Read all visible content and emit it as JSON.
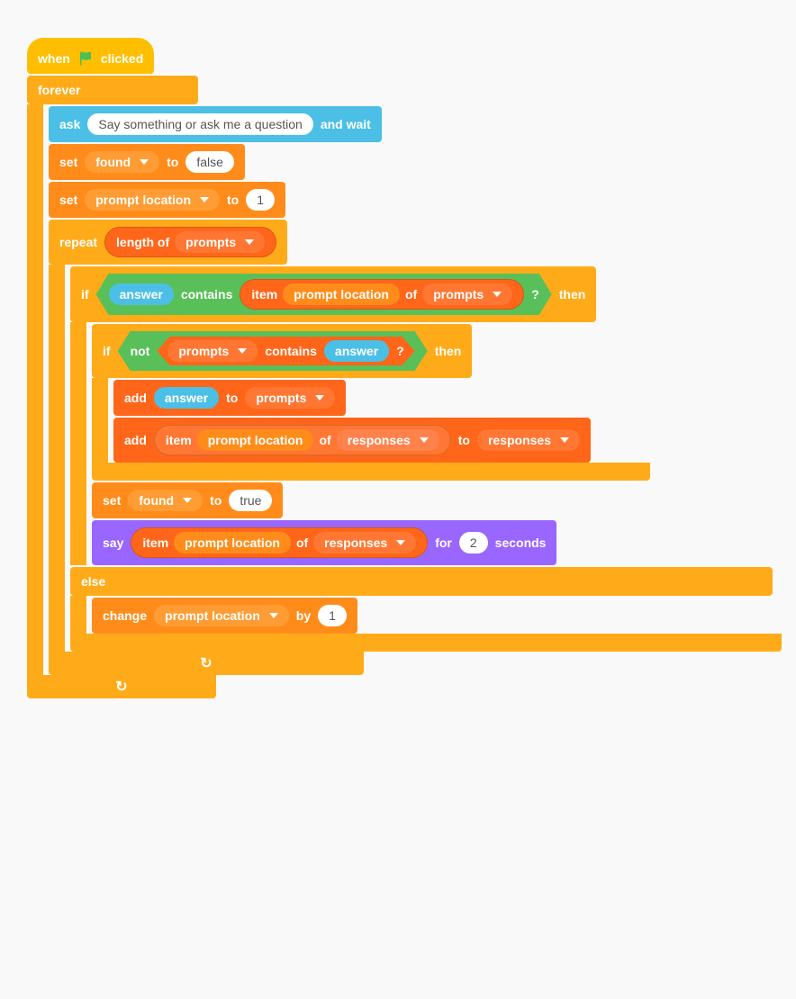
{
  "hat": {
    "when": "when",
    "clicked": "clicked"
  },
  "forever": "forever",
  "ask": {
    "label": "ask",
    "prompt": "Say something or ask me a question",
    "wait": "and wait"
  },
  "set1": {
    "set": "set",
    "var": "found",
    "to": "to",
    "val": "false"
  },
  "set2": {
    "set": "set",
    "var": "prompt location",
    "to": "to",
    "val": "1"
  },
  "repeat": {
    "label": "repeat",
    "lenof": "length of",
    "list": "prompts"
  },
  "if1": {
    "if": "if",
    "then": "then",
    "answer": "answer",
    "contains": "contains",
    "item": "item",
    "var": "prompt location",
    "of": "of",
    "list": "prompts",
    "q": "?"
  },
  "if2": {
    "if": "if",
    "then": "then",
    "not": "not",
    "list": "prompts",
    "contains": "contains",
    "answer": "answer",
    "q": "?"
  },
  "add1": {
    "add": "add",
    "answer": "answer",
    "to": "to",
    "list": "prompts"
  },
  "add2": {
    "add": "add",
    "item": "item",
    "var": "prompt location",
    "of": "of",
    "list1": "responses",
    "to": "to",
    "list2": "responses"
  },
  "set3": {
    "set": "set",
    "var": "found",
    "to": "to",
    "val": "true"
  },
  "say": {
    "say": "say",
    "item": "item",
    "var": "prompt location",
    "of": "of",
    "list": "responses",
    "for": "for",
    "secs_val": "2",
    "secs": "seconds"
  },
  "else": "else",
  "change": {
    "change": "change",
    "var": "prompt location",
    "by": "by",
    "val": "1"
  },
  "loop_arrow": "↻"
}
